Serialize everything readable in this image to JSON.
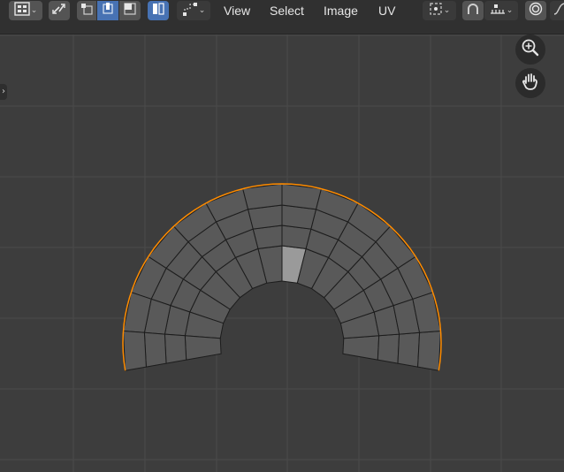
{
  "header": {
    "menus": [
      "View",
      "Select",
      "Image",
      "UV"
    ]
  },
  "icons": {
    "editor_type": "uv-editor-icon",
    "sync_selection": "sync-selection-icon",
    "select_modes": [
      "vertex-select-icon",
      "edge-select-icon",
      "face-select-icon"
    ],
    "sticky_mode": "island-select-icon",
    "pivot": "pivot-point-icon",
    "snap": "snap-icon",
    "snap_target": "snap-increment-icon",
    "proportional": "proportional-editing-icon",
    "zoom": "zoom-in-icon",
    "pan": "hand-pan-icon"
  },
  "colors": {
    "background": "#3d3d3d",
    "grid": "#4a4a4a",
    "face": "#595959",
    "edge": "#1c1c1c",
    "boundary": "#ff8c00",
    "selected_face": "#9a9a9a",
    "active_toggle": "#4772b3"
  }
}
